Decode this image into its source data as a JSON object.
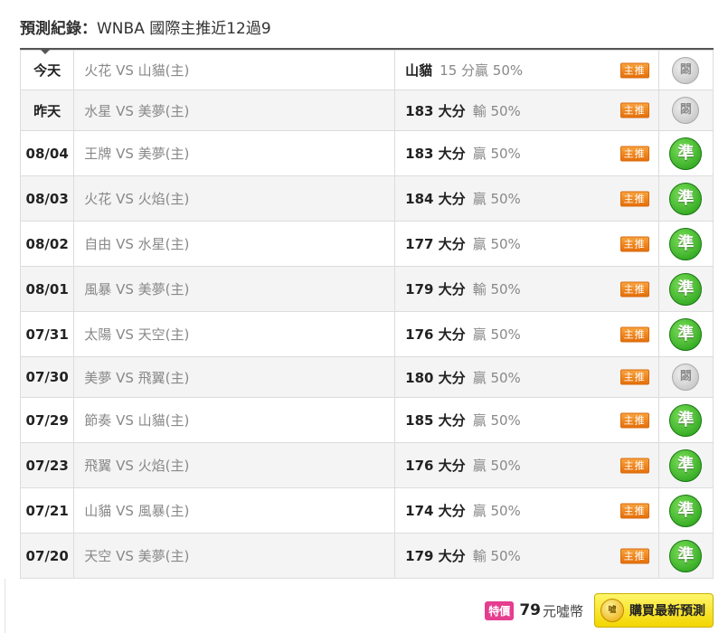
{
  "header": {
    "title_bold": "預測紀錄：",
    "title_rest": "WNBA 國際主推近12過9"
  },
  "tag_label": "主推",
  "badges": {
    "pending": "�St",
    "hit": "準"
  },
  "rows": [
    {
      "date": "今天",
      "match": "火花 VS 山貓(主)",
      "pick": "山貓",
      "result": "15 分贏 50%",
      "status": "閟"
    },
    {
      "date": "昨天",
      "match": "水星 VS 美夢(主)",
      "pick": "183 大分",
      "result": "輸 50%",
      "status": "閟"
    },
    {
      "date": "08/04",
      "match": "王牌 VS 美夢(主)",
      "pick": "183 大分",
      "result": "贏 50%",
      "status": "準"
    },
    {
      "date": "08/03",
      "match": "火花 VS 火焰(主)",
      "pick": "184 大分",
      "result": "贏 50%",
      "status": "準"
    },
    {
      "date": "08/02",
      "match": "自由 VS 水星(主)",
      "pick": "177 大分",
      "result": "贏 50%",
      "status": "準"
    },
    {
      "date": "08/01",
      "match": "風暴 VS 美夢(主)",
      "pick": "179 大分",
      "result": "輸 50%",
      "status": "準"
    },
    {
      "date": "07/31",
      "match": "太陽 VS 天空(主)",
      "pick": "176 大分",
      "result": "贏 50%",
      "status": "準"
    },
    {
      "date": "07/30",
      "match": "美夢 VS 飛翼(主)",
      "pick": "180 大分",
      "result": "贏 50%",
      "status": "閟"
    },
    {
      "date": "07/29",
      "match": "節奏 VS 山貓(主)",
      "pick": "185 大分",
      "result": "贏 50%",
      "status": "準"
    },
    {
      "date": "07/23",
      "match": "飛翼 VS 火焰(主)",
      "pick": "176 大分",
      "result": "贏 50%",
      "status": "準"
    },
    {
      "date": "07/21",
      "match": "山貓 VS 風暴(主)",
      "pick": "174 大分",
      "result": "贏 50%",
      "status": "準"
    },
    {
      "date": "07/20",
      "match": "天空 VS 美夢(主)",
      "pick": "179 大分",
      "result": "輸 50%",
      "status": "準"
    }
  ],
  "footer": {
    "special_label": "特價",
    "price": "79",
    "unit": "元噓幣",
    "coin_label": "噓",
    "buy_label": "購買最新預測"
  }
}
